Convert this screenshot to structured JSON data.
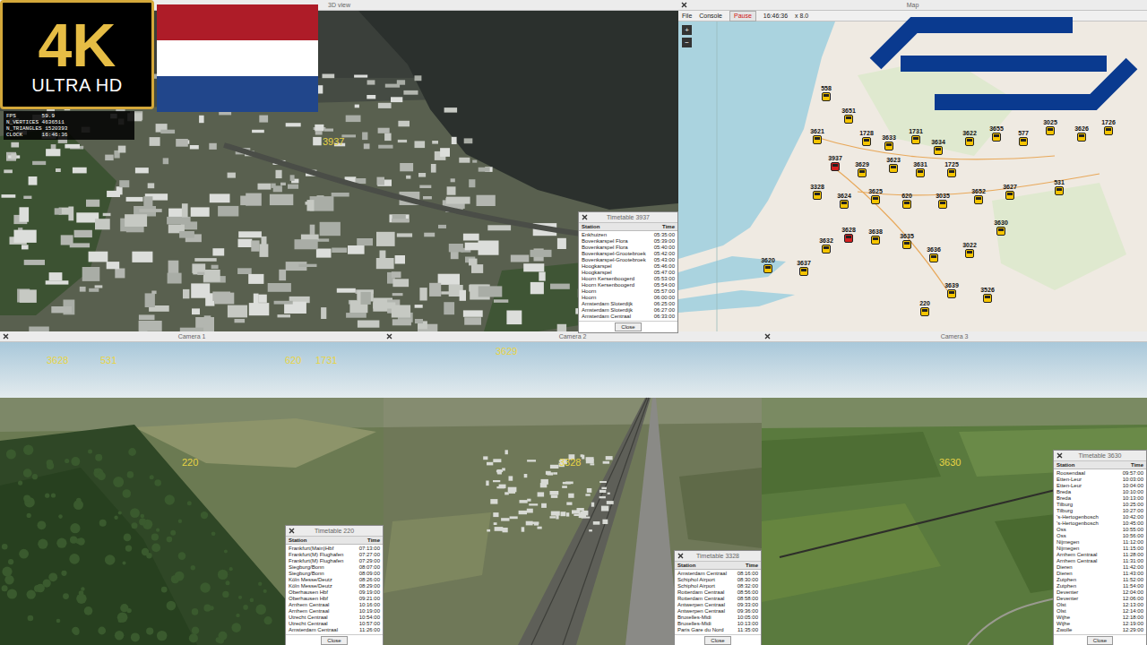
{
  "badge": {
    "big": "4K",
    "small": "ULTRA HD"
  },
  "overlay": [
    "FPS        59.9",
    "N_VERTICES 4636511",
    "N_TRIANGLES 1520393",
    "CLOCK      16:46:36"
  ],
  "main_view": {
    "title": "3D view",
    "labels": [
      "3937"
    ]
  },
  "map": {
    "title": "Map",
    "menu": [
      "File",
      "Console"
    ],
    "pause": "Pause",
    "clock": "16:46:36",
    "speed": "x 8.0",
    "zoom": [
      "+",
      "−"
    ],
    "trains": [
      {
        "label": "558",
        "color": "#f5c400"
      },
      {
        "label": "3651",
        "color": "#f5c400"
      },
      {
        "label": "3621",
        "color": "#f5c400"
      },
      {
        "label": "1728",
        "color": "#f5c400"
      },
      {
        "label": "3633",
        "color": "#f5c400"
      },
      {
        "label": "1731",
        "color": "#f5c400"
      },
      {
        "label": "3634",
        "color": "#f5c400"
      },
      {
        "label": "3622",
        "color": "#f5c400"
      },
      {
        "label": "3655",
        "color": "#f5c400"
      },
      {
        "label": "577",
        "color": "#f5c400"
      },
      {
        "label": "3025",
        "color": "#f5c400"
      },
      {
        "label": "3626",
        "color": "#f5c400"
      },
      {
        "label": "1726",
        "color": "#f5c400"
      },
      {
        "label": "3937",
        "color": "#d42020"
      },
      {
        "label": "3629",
        "color": "#f5c400"
      },
      {
        "label": "3623",
        "color": "#f5c400"
      },
      {
        "label": "3631",
        "color": "#f5c400"
      },
      {
        "label": "1725",
        "color": "#f5c400"
      },
      {
        "label": "3328",
        "color": "#f5c400"
      },
      {
        "label": "3624",
        "color": "#f5c400"
      },
      {
        "label": "3625",
        "color": "#f5c400"
      },
      {
        "label": "620",
        "color": "#f5c400"
      },
      {
        "label": "3035",
        "color": "#f5c400"
      },
      {
        "label": "3652",
        "color": "#f5c400"
      },
      {
        "label": "3627",
        "color": "#f5c400"
      },
      {
        "label": "531",
        "color": "#f5c400"
      },
      {
        "label": "3628",
        "color": "#d42020"
      },
      {
        "label": "3632",
        "color": "#f5c400"
      },
      {
        "label": "3638",
        "color": "#f5c400"
      },
      {
        "label": "3635",
        "color": "#f5c400"
      },
      {
        "label": "3636",
        "color": "#f5c400"
      },
      {
        "label": "3022",
        "color": "#f5c400"
      },
      {
        "label": "3620",
        "color": "#f5c400"
      },
      {
        "label": "3637",
        "color": "#f5c400"
      },
      {
        "label": "3630",
        "color": "#f5c400"
      },
      {
        "label": "3639",
        "color": "#f5c400"
      },
      {
        "label": "3526",
        "color": "#f5c400"
      },
      {
        "label": "220",
        "color": "#f5c400"
      }
    ]
  },
  "views": [
    {
      "title": "Camera 1",
      "labels": [
        "3628",
        "531",
        "620",
        "1731",
        "220"
      ]
    },
    {
      "title": "Camera 2",
      "labels": [
        "3629",
        "3328"
      ]
    },
    {
      "title": "Camera 3",
      "labels": [
        "3630"
      ]
    }
  ],
  "timetables": [
    {
      "title": "Timetable 3937",
      "columns": [
        "Station",
        "Time"
      ],
      "button": "Close",
      "rows": [
        [
          "Enkhuizen",
          "05:35:00"
        ],
        [
          "Bovenkarspel Flora",
          "05:39:00"
        ],
        [
          "Bovenkarspel Flora",
          "05:40:00"
        ],
        [
          "Bovenkarspel-Grootebroek",
          "05:42:00"
        ],
        [
          "Bovenkarspel-Grootebroek",
          "05:43:00"
        ],
        [
          "Hoogkarspel",
          "05:46:00"
        ],
        [
          "Hoogkarspel",
          "05:47:00"
        ],
        [
          "Hoorn Kersenboogerd",
          "05:53:00"
        ],
        [
          "Hoorn Kersenboogerd",
          "05:54:00"
        ],
        [
          "Hoorn",
          "05:57:00"
        ],
        [
          "Hoorn",
          "06:00:00"
        ],
        [
          "Amsterdam Sloterdijk",
          "06:25:00"
        ],
        [
          "Amsterdam Sloterdijk",
          "06:27:00"
        ],
        [
          "Amsterdam Centraal",
          "06:33:00"
        ]
      ]
    },
    {
      "title": "Timetable 220",
      "columns": [
        "Station",
        "Time"
      ],
      "button": "Close",
      "rows": [
        [
          "Frankfurt(Main)Hbf",
          "07:13:00"
        ],
        [
          "Frankfurt(M) Flughafen",
          "07:27:00"
        ],
        [
          "Frankfurt(M) Flughafen",
          "07:29:00"
        ],
        [
          "Siegburg/Bonn",
          "08:07:00"
        ],
        [
          "Siegburg/Bonn",
          "08:09:00"
        ],
        [
          "Köln Messe/Deutz",
          "08:26:00"
        ],
        [
          "Köln Messe/Deutz",
          "08:29:00"
        ],
        [
          "Oberhausen Hbf",
          "09:19:00"
        ],
        [
          "Oberhausen Hbf",
          "09:21:00"
        ],
        [
          "Arnhem Centraal",
          "10:16:00"
        ],
        [
          "Arnhem Centraal",
          "10:19:00"
        ],
        [
          "Utrecht Centraal",
          "10:54:00"
        ],
        [
          "Utrecht Centraal",
          "10:57:00"
        ],
        [
          "Amsterdam Centraal",
          "11:26:00"
        ]
      ]
    },
    {
      "title": "Timetable 3328",
      "columns": [
        "Station",
        "Time"
      ],
      "button": "Close",
      "rows": [
        [
          "Amsterdam Centraal",
          "08:16:00"
        ],
        [
          "Schiphol Airport",
          "08:30:00"
        ],
        [
          "Schiphol Airport",
          "08:32:00"
        ],
        [
          "Rotterdam Centraal",
          "08:56:00"
        ],
        [
          "Rotterdam Centraal",
          "08:58:00"
        ],
        [
          "Antwerpen Centraal",
          "09:33:00"
        ],
        [
          "Antwerpen Centraal",
          "09:36:00"
        ],
        [
          "Bruxelles-Midi",
          "10:05:00"
        ],
        [
          "Bruxelles-Midi",
          "10:13:00"
        ],
        [
          "Paris Gare du Nord",
          "11:35:00"
        ]
      ]
    },
    {
      "title": "Timetable 3630",
      "columns": [
        "Station",
        "Time"
      ],
      "button": "Close",
      "rows": [
        [
          "Roosendaal",
          "09:57:00"
        ],
        [
          "Etten-Leur",
          "10:03:00"
        ],
        [
          "Etten-Leur",
          "10:04:00"
        ],
        [
          "Breda",
          "10:10:00"
        ],
        [
          "Breda",
          "10:13:00"
        ],
        [
          "Tilburg",
          "10:25:00"
        ],
        [
          "Tilburg",
          "10:27:00"
        ],
        [
          "'s-Hertogenbosch",
          "10:42:00"
        ],
        [
          "'s-Hertogenbosch",
          "10:45:00"
        ],
        [
          "Oss",
          "10:55:00"
        ],
        [
          "Oss",
          "10:56:00"
        ],
        [
          "Nijmegen",
          "11:12:00"
        ],
        [
          "Nijmegen",
          "11:15:00"
        ],
        [
          "Arnhem Centraal",
          "11:28:00"
        ],
        [
          "Arnhem Centraal",
          "11:31:00"
        ],
        [
          "Dieren",
          "11:42:00"
        ],
        [
          "Dieren",
          "11:43:00"
        ],
        [
          "Zutphen",
          "11:52:00"
        ],
        [
          "Zutphen",
          "11:54:00"
        ],
        [
          "Deventer",
          "12:04:00"
        ],
        [
          "Deventer",
          "12:06:00"
        ],
        [
          "Olst",
          "12:13:00"
        ],
        [
          "Olst",
          "12:14:00"
        ],
        [
          "Wijhe",
          "12:18:00"
        ],
        [
          "Wijhe",
          "12:19:00"
        ],
        [
          "Zwolle",
          "12:29:00"
        ]
      ]
    }
  ]
}
